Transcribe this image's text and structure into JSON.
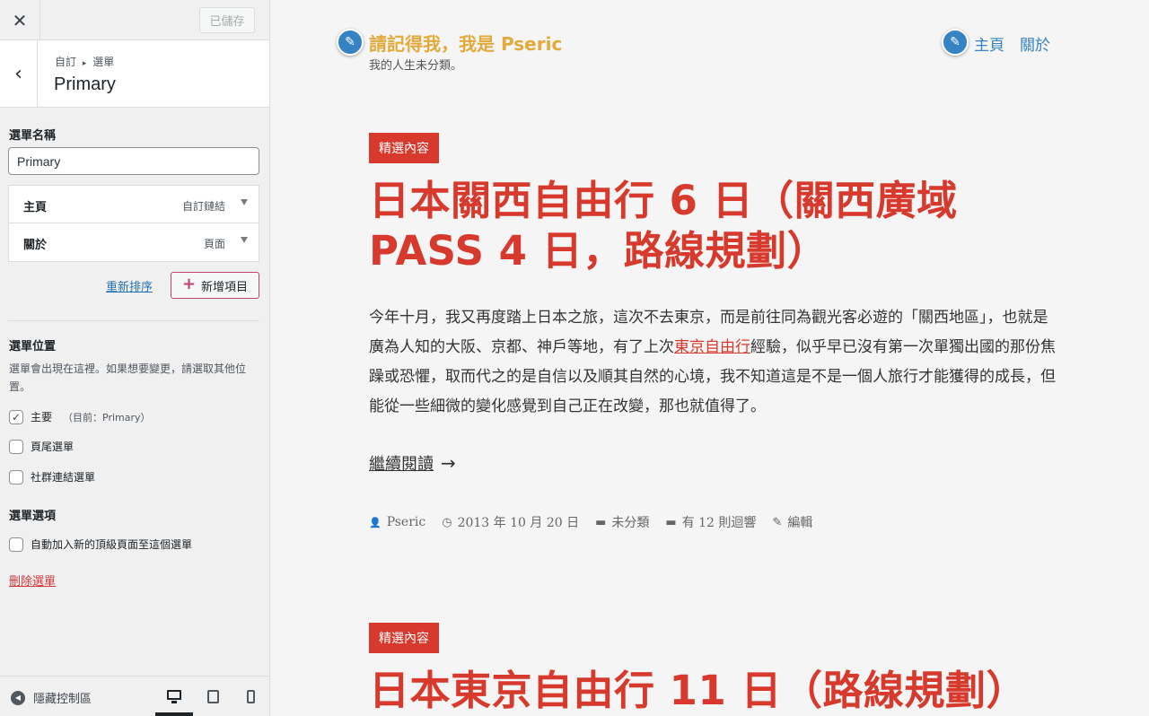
{
  "sidebar": {
    "close_icon": "✕",
    "saved_label": "已儲存",
    "breadcrumb_parent": "自訂",
    "breadcrumb_sep": "▸",
    "breadcrumb_current": "選單",
    "section_title": "Primary",
    "menu_name_label": "選單名稱",
    "menu_name_value": "Primary",
    "menu_items": [
      {
        "title": "主頁",
        "type": "自訂鏈結"
      },
      {
        "title": "關於",
        "type": "頁面"
      }
    ],
    "reorder_label": "重新排序",
    "add_items_label": "新增項目",
    "locations_label": "選單位置",
    "locations_desc": "選單會出現在這裡。如果想要變更，請選取其他位置。",
    "locations": [
      {
        "label": "主要",
        "note": "（目前：Primary）",
        "checked": true
      },
      {
        "label": "頁尾選單",
        "note": "",
        "checked": false
      },
      {
        "label": "社群連結選單",
        "note": "",
        "checked": false
      }
    ],
    "options_label": "選單選項",
    "auto_add_label": "自動加入新的頂級頁面至這個選單",
    "delete_label": "刪除選單",
    "hide_controls_label": "隱藏控制區"
  },
  "preview": {
    "site_title": "請記得我，我是 Pseric",
    "tagline": "我的人生未分類。",
    "nav": [
      "主頁",
      "關於"
    ],
    "posts": [
      {
        "category": "精選內容",
        "title": "日本關西自由行 6 日（關西廣域 PASS 4 日，路線規劃）",
        "excerpt_before": "今年十月，我又再度踏上日本之旅，這次不去東京，而是前往同為觀光客必遊的「關西地區」，也就是廣為人知的大阪、京都、神戶等地，有了上次",
        "excerpt_link": "東京自由行",
        "excerpt_after": "經驗，似乎早已沒有第一次單獨出國的那份焦躁或恐懼，取而代之的是自信以及順其自然的心境，我不知道這是不是一個人旅行才能獲得的成長，但能從一些細微的變化感覺到自己正在改變，那也就值得了。",
        "read_more": "繼續閱讀",
        "read_more_arrow": "→",
        "meta": {
          "author": "Pseric",
          "date": "2013 年 10 月 20 日",
          "category": "未分類",
          "comments": "有 12 則迴響",
          "edit": "編輯"
        }
      },
      {
        "category": "精選內容",
        "title": "日本東京自由行 11 日（路線規劃）"
      }
    ]
  },
  "colors": {
    "accent_red": "#d8392d",
    "site_title_gold": "#e2a93b",
    "link_blue": "#3582c4",
    "wp_blue": "#2271b1",
    "wp_delete": "#d63638"
  },
  "icons": {
    "pencil": "✎",
    "back": "‹",
    "plus": "+",
    "check": "✓",
    "hide": "◀",
    "author": "👤",
    "clock": "◷",
    "folder": "▬",
    "comment": "▬",
    "edit": "✎"
  }
}
